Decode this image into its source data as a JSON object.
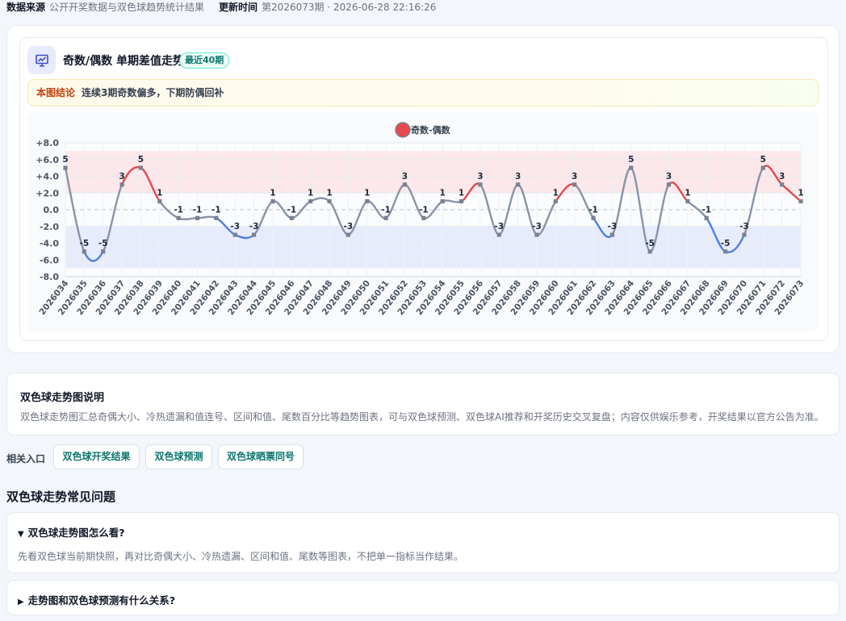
{
  "meta": {
    "source_label": "数据来源",
    "source_value": "公开开奖数据与双色球趋势统计结果",
    "updated_label": "更新时间",
    "updated_value": "第2026073期 · 2026-06-28 22:16:26"
  },
  "chart_card": {
    "title": "奇数/偶数 单期差值走势",
    "badge": "最近40期",
    "conclusion_label": "本图结论",
    "conclusion_text": "连续3期奇数偏多，下期防偶回补",
    "icon": "presentation-chart-icon"
  },
  "chart_data": {
    "type": "line",
    "legend": [
      {
        "name": "奇数-偶数",
        "color": "#e5484d"
      }
    ],
    "x": [
      "2026034",
      "2026035",
      "2026036",
      "2026037",
      "2026038",
      "2026039",
      "2026040",
      "2026041",
      "2026042",
      "2026043",
      "2026044",
      "2026045",
      "2026046",
      "2026047",
      "2026048",
      "2026049",
      "2026050",
      "2026051",
      "2026052",
      "2026053",
      "2026054",
      "2026055",
      "2026056",
      "2026057",
      "2026058",
      "2026059",
      "2026060",
      "2026061",
      "2026062",
      "2026063",
      "2026064",
      "2026065",
      "2026066",
      "2026067",
      "2026068",
      "2026069",
      "2026070",
      "2026071",
      "2026072",
      "2026073"
    ],
    "series": [
      {
        "name": "奇数-偶数",
        "values": [
          5,
          -5,
          -5,
          3,
          5,
          1,
          -1,
          -1,
          -1,
          -3,
          -3,
          1,
          -1,
          1,
          1,
          -3,
          1,
          -1,
          3,
          -1,
          1,
          1,
          3,
          -3,
          3,
          -3,
          1,
          3,
          -1,
          -3,
          5,
          -5,
          3,
          1,
          -1,
          -5,
          -3,
          5,
          3,
          1
        ]
      }
    ],
    "yticks": [
      "+8.0",
      "+6.0",
      "+4.0",
      "+2.0",
      "0.0",
      "-2.0",
      "-4.0",
      "-6.0",
      "-8.0"
    ],
    "ylim": [
      -8,
      8
    ],
    "bands": [
      {
        "from": 2,
        "to": 7,
        "color": "#fbe3e6"
      },
      {
        "from": -7,
        "to": -2,
        "color": "#e3e9fb"
      }
    ],
    "colors": {
      "odd_bias": "#e5484d",
      "even_bias": "#4f7fe0",
      "neutral": "#8893a5"
    },
    "grid": true,
    "legend_position": "top-center"
  },
  "desc": {
    "title": "双色球走势图说明",
    "text": "双色球走势图汇总奇偶大小、冷热遗漏和值连号、区间和值、尾数百分比等趋势图表，可与双色球预测、双色球AI推荐和开奖历史交叉复盘；内容仅供娱乐参考，开奖结果以官方公告为准。"
  },
  "related": {
    "label": "相关入口",
    "links": [
      "双色球开奖结果",
      "双色球预测",
      "双色球晒票同号"
    ]
  },
  "faq": {
    "heading": "双色球走势常见问题",
    "items": [
      {
        "arrow": "▼",
        "question": "双色球走势图怎么看?",
        "answer": "先看双色球当前期快照，再对比奇偶大小、冷热遗漏、区间和值、尾数等图表，不把单一指标当作结果。"
      },
      {
        "arrow": "▶",
        "question": "走势图和双色球预测有什么关系?"
      }
    ]
  }
}
